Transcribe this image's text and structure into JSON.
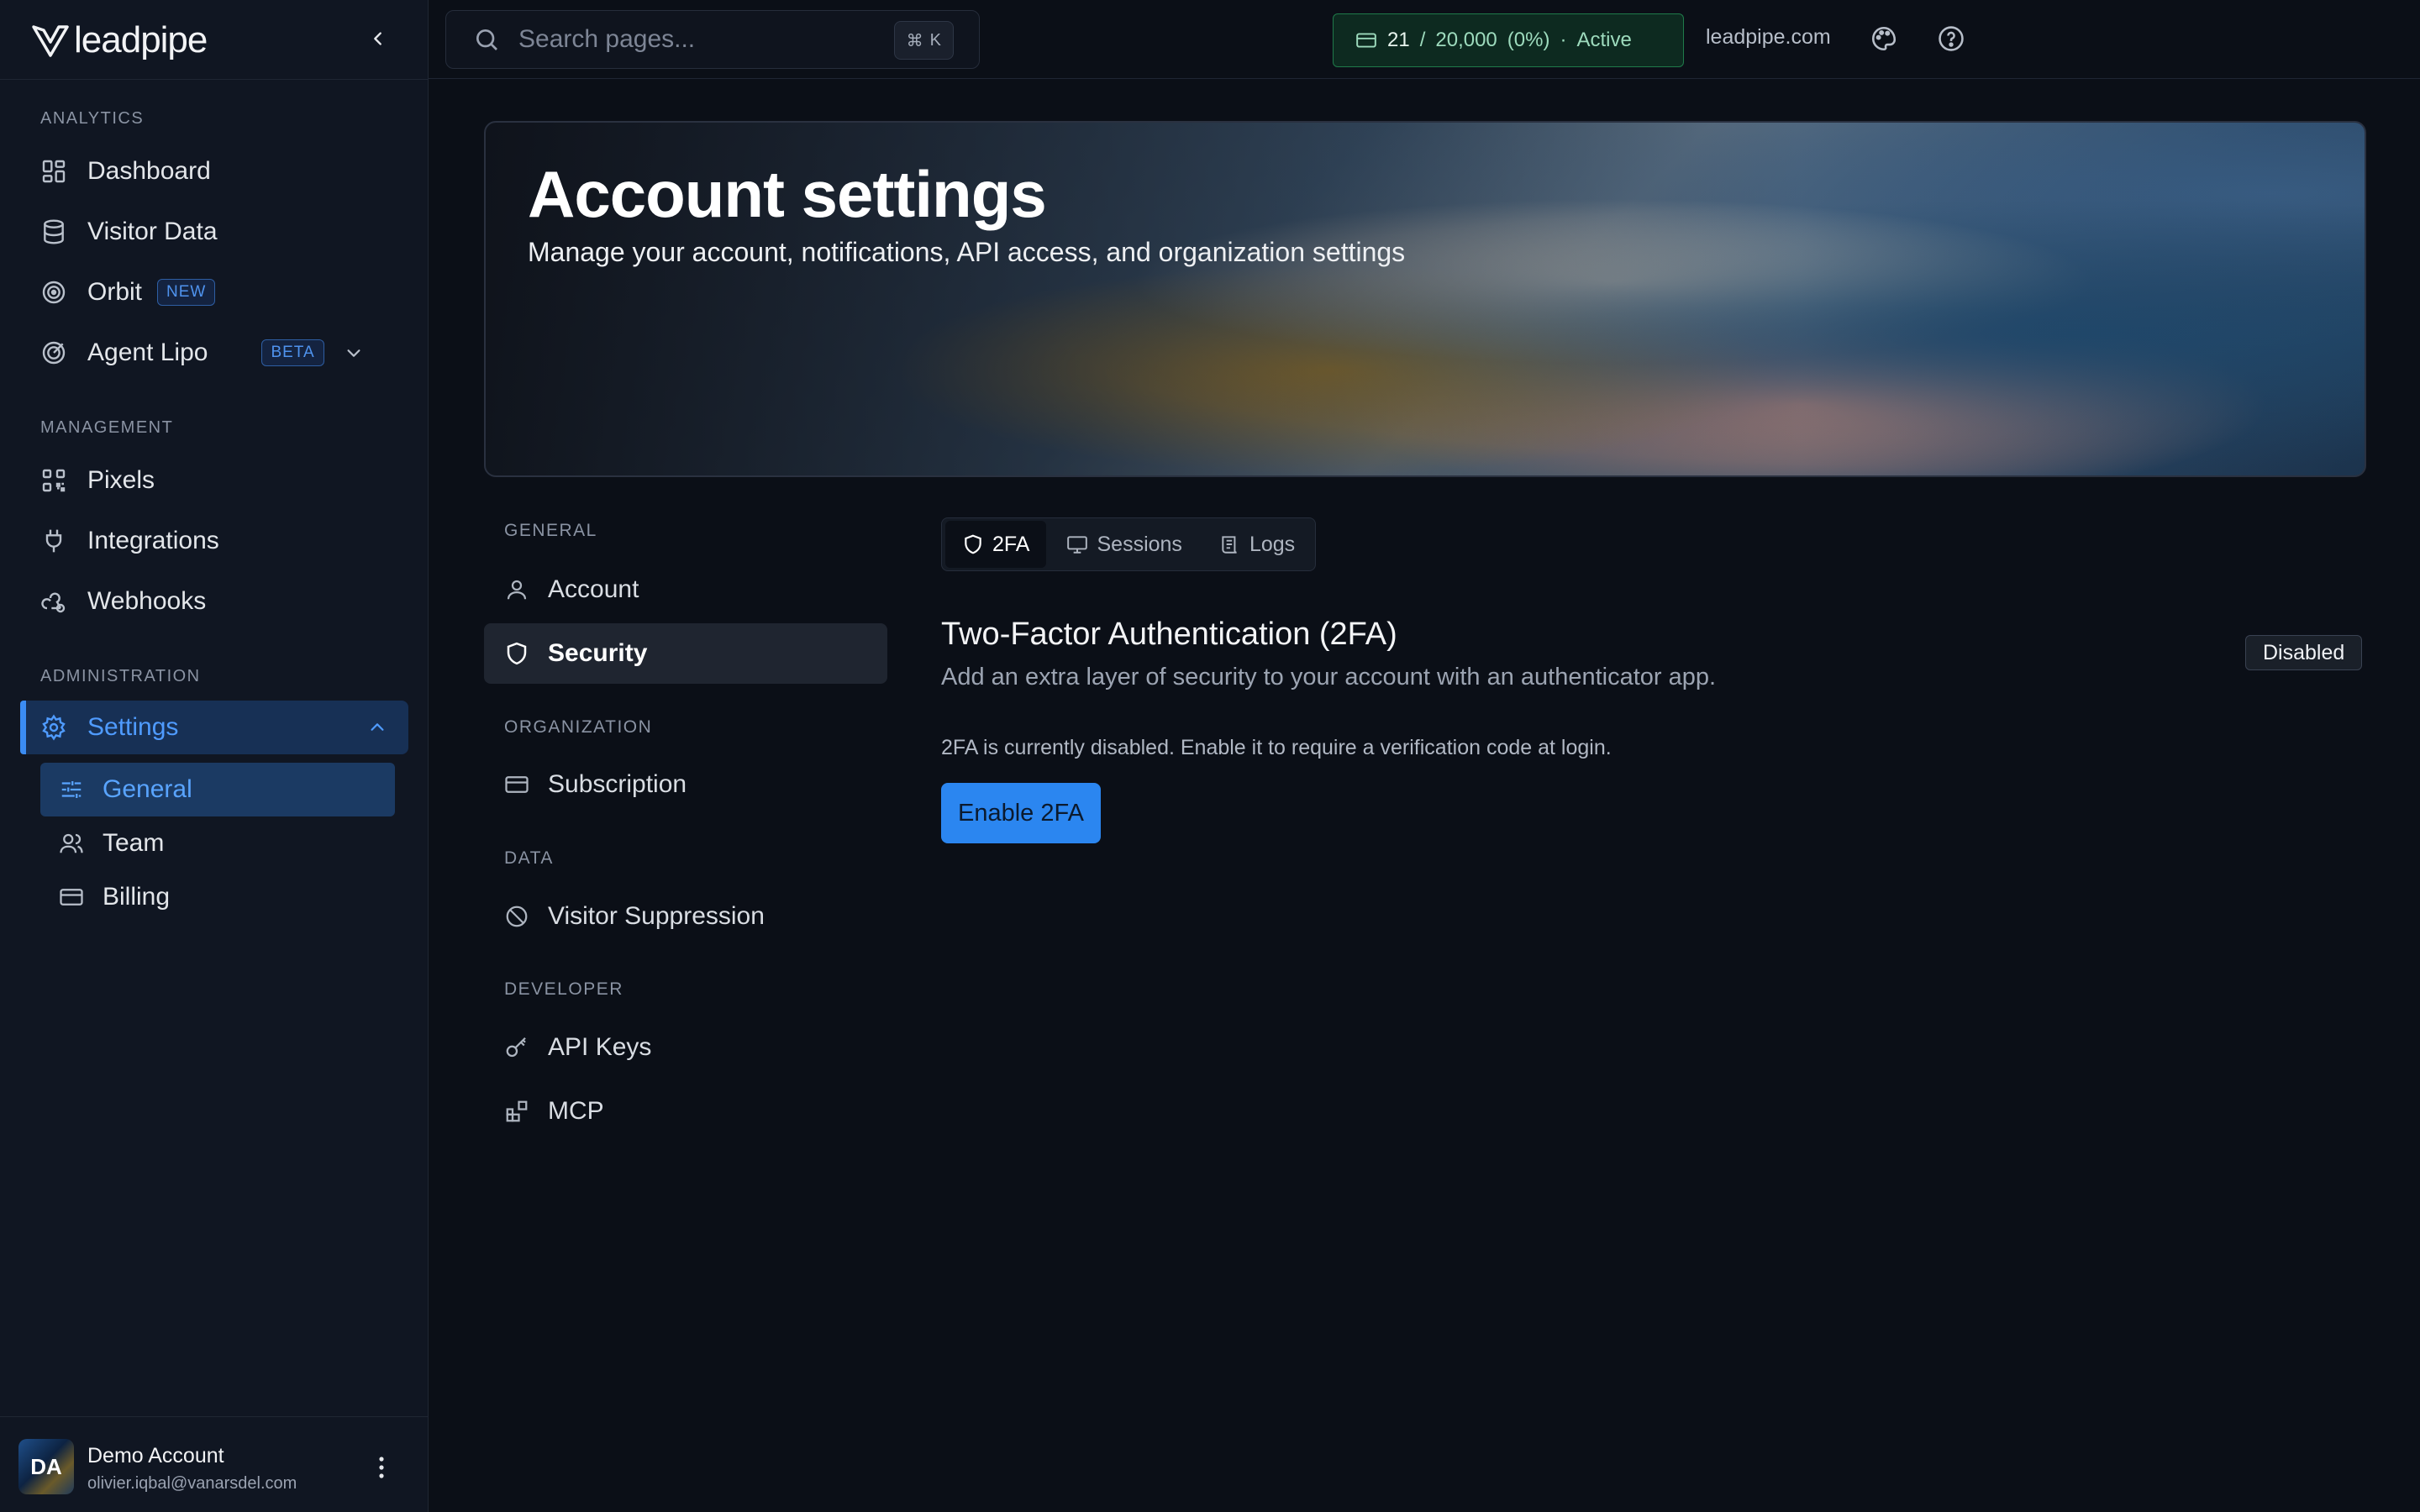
{
  "brand": {
    "name": "leadpipe"
  },
  "sidebar": {
    "sections": {
      "analytics": "ANALYTICS",
      "management": "MANAGEMENT",
      "administration": "ADMINISTRATION"
    },
    "items": {
      "dashboard": "Dashboard",
      "visitor_data": "Visitor Data",
      "orbit": "Orbit",
      "orbit_badge": "NEW",
      "agent_lipo": "Agent Lipo",
      "agent_lipo_badge": "BETA",
      "pixels": "Pixels",
      "integrations": "Integrations",
      "webhooks": "Webhooks",
      "settings": "Settings"
    },
    "sub_items": {
      "general": "General",
      "team": "Team",
      "billing": "Billing"
    },
    "user": {
      "initials": "DA",
      "name": "Demo Account",
      "email": "olivier.iqbal@vanarsdel.com"
    }
  },
  "topbar": {
    "search_placeholder": "Search pages...",
    "shortcut_symbol": "⌘",
    "shortcut_key": "K",
    "usage": {
      "used": "21",
      "separator": "/",
      "limit": "20,000",
      "percent": "(0%)",
      "dot": "·",
      "status": "Active"
    },
    "domain": "leadpipe.com"
  },
  "hero": {
    "title": "Account settings",
    "subtitle": "Manage your account, notifications, API access, and organization settings"
  },
  "settings_nav": {
    "general_label": "GENERAL",
    "account": "Account",
    "security": "Security",
    "organization_label": "ORGANIZATION",
    "subscription": "Subscription",
    "data_label": "DATA",
    "visitor_suppression": "Visitor Suppression",
    "developer_label": "DEVELOPER",
    "api_keys": "API Keys",
    "mcp": "MCP"
  },
  "security": {
    "tabs": {
      "twofa": "2FA",
      "sessions": "Sessions",
      "logs": "Logs"
    },
    "title": "Two-Factor Authentication (2FA)",
    "description": "Add an extra layer of security to your account with an authenticator app.",
    "status": "Disabled",
    "note": "2FA is currently disabled. Enable it to require a verification code at login.",
    "enable_button": "Enable 2FA"
  },
  "colors": {
    "accent": "#2b86f0",
    "active_nav_bg": "#173055",
    "usage_green": "#1f7a4a",
    "background": "#0b0f17",
    "sidebar_bg": "#101622"
  },
  "icons": {
    "collapse": "chevron-left-icon",
    "search": "search-icon",
    "usage": "credit-card-icon",
    "theme": "palette-icon",
    "help": "help-circle-icon"
  }
}
